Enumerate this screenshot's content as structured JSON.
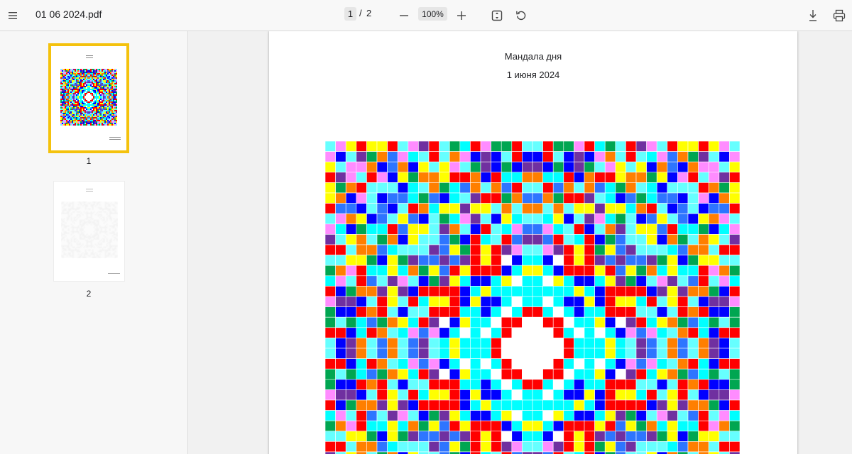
{
  "file_name": "01 06 2024.pdf",
  "current_page": "1",
  "page_separator": "/",
  "total_pages": "2",
  "zoom": "100%",
  "document": {
    "title": "Мандала дня",
    "date": "1 июня 2024"
  },
  "thumbnails": [
    {
      "label": "1",
      "selected": true
    },
    {
      "label": "2",
      "selected": false
    }
  ],
  "icons": {
    "menu": "hamburger-menu-icon",
    "zoom_out": "minus-icon",
    "zoom_in": "plus-icon",
    "fit": "fit-to-page-icon",
    "rotate": "rotate-counterclockwise-icon",
    "download": "download-icon",
    "print": "print-icon"
  },
  "colors": {
    "selection_outline": "#f4c20d",
    "mandala_palette": [
      "#ff0000",
      "#0000ff",
      "#ffff00",
      "#00ffff",
      "#66ffff",
      "#ff8cff",
      "#ff7f00",
      "#00a651",
      "#7030a0",
      "#2e75ff",
      "#ffffff",
      "#ff2020"
    ]
  }
}
